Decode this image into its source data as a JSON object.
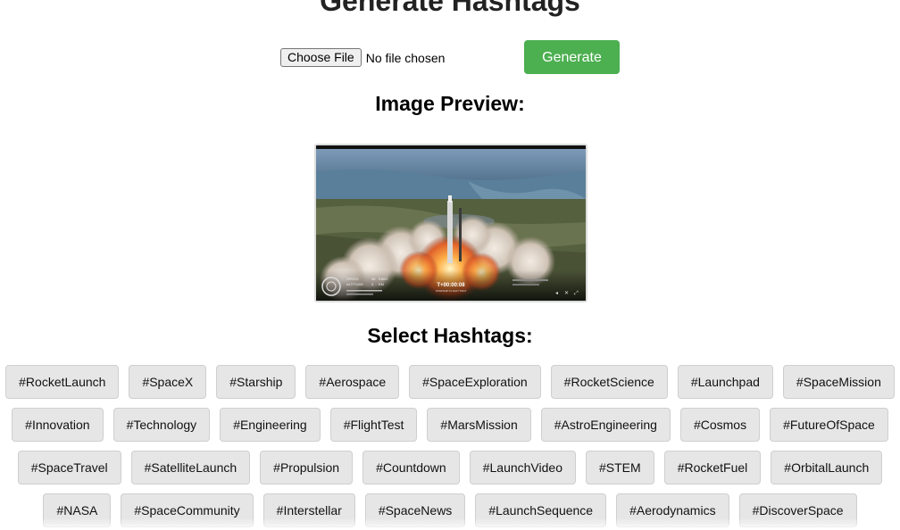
{
  "page": {
    "title": "Generate Hashtags"
  },
  "upload": {
    "choose_label": "Choose File",
    "status": "No file chosen",
    "generate_label": "Generate"
  },
  "preview": {
    "heading": "Image Preview:",
    "overlay": {
      "speed_label": "SPEED",
      "speed_value": "56",
      "speed_unit": "KM/H",
      "altitude_label": "ALTITUDE",
      "altitude_value": "0",
      "altitude_unit": "KM",
      "timer": "T+00:00:08",
      "event": "STARSHIP FLIGHT TEST"
    }
  },
  "hashtags": {
    "heading": "Select Hashtags:",
    "rows": [
      [
        "#RocketLaunch",
        "#SpaceX",
        "#Starship",
        "#Aerospace",
        "#SpaceExploration",
        "#RocketScience",
        "#Launchpad",
        "#SpaceMission"
      ],
      [
        "#Innovation",
        "#Technology",
        "#Engineering",
        "#FlightTest",
        "#MarsMission",
        "#AstroEngineering",
        "#Cosmos",
        "#FutureOfSpace"
      ],
      [
        "#SpaceTravel",
        "#SatelliteLaunch",
        "#Propulsion",
        "#Countdown",
        "#LaunchVideo",
        "#STEM",
        "#RocketFuel",
        "#OrbitalLaunch"
      ],
      [
        "#NASA",
        "#SpaceCommunity",
        "#Interstellar",
        "#SpaceNews",
        "#LaunchSequence",
        "#Aerodynamics",
        "#DiscoverSpace"
      ]
    ]
  },
  "colors": {
    "generate_button": "#4caf50",
    "tag_background": "#e6e6e6"
  }
}
